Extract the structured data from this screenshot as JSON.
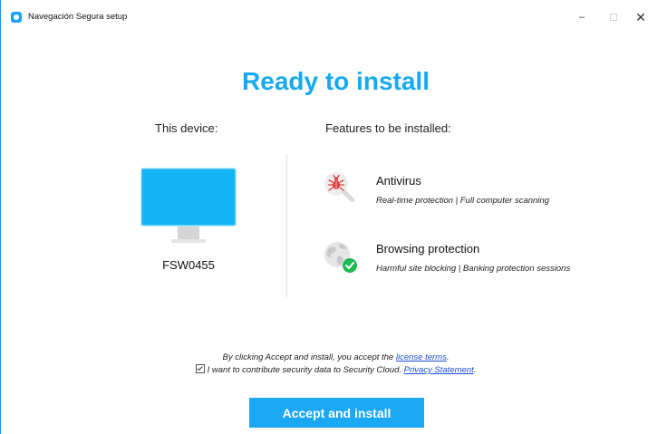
{
  "window": {
    "title": "Navegación Segura setup",
    "minimize_symbol": "–",
    "maximize_symbol": "☐",
    "close_symbol": "✕"
  },
  "heading": "Ready to install",
  "device_column": {
    "title": "This device:",
    "device_name": "FSW0455"
  },
  "features_column": {
    "title": "Features to be installed:",
    "features": [
      {
        "icon": "bug-icon",
        "title": "Antivirus",
        "description": "Real-time protection | Full computer scanning"
      },
      {
        "icon": "globe-shield-icon",
        "title": "Browsing protection",
        "description": "Harmful site blocking | Banking protection sessions"
      }
    ]
  },
  "consent": {
    "line1_prefix": "By clicking Accept and install, you accept the ",
    "license_link": "license terms",
    "line1_suffix": ".",
    "checkbox_checked": true,
    "line2_prefix": "I want to contribute security data to Security Cloud. ",
    "privacy_link": "Privacy Statement",
    "line2_suffix": "."
  },
  "install_button": "Accept and install",
  "colors": {
    "accent": "#16aaf0",
    "button": "#1aa7f4",
    "link": "#1a4fd0",
    "bug_red": "#e23c3c",
    "shield_green": "#1db954"
  }
}
